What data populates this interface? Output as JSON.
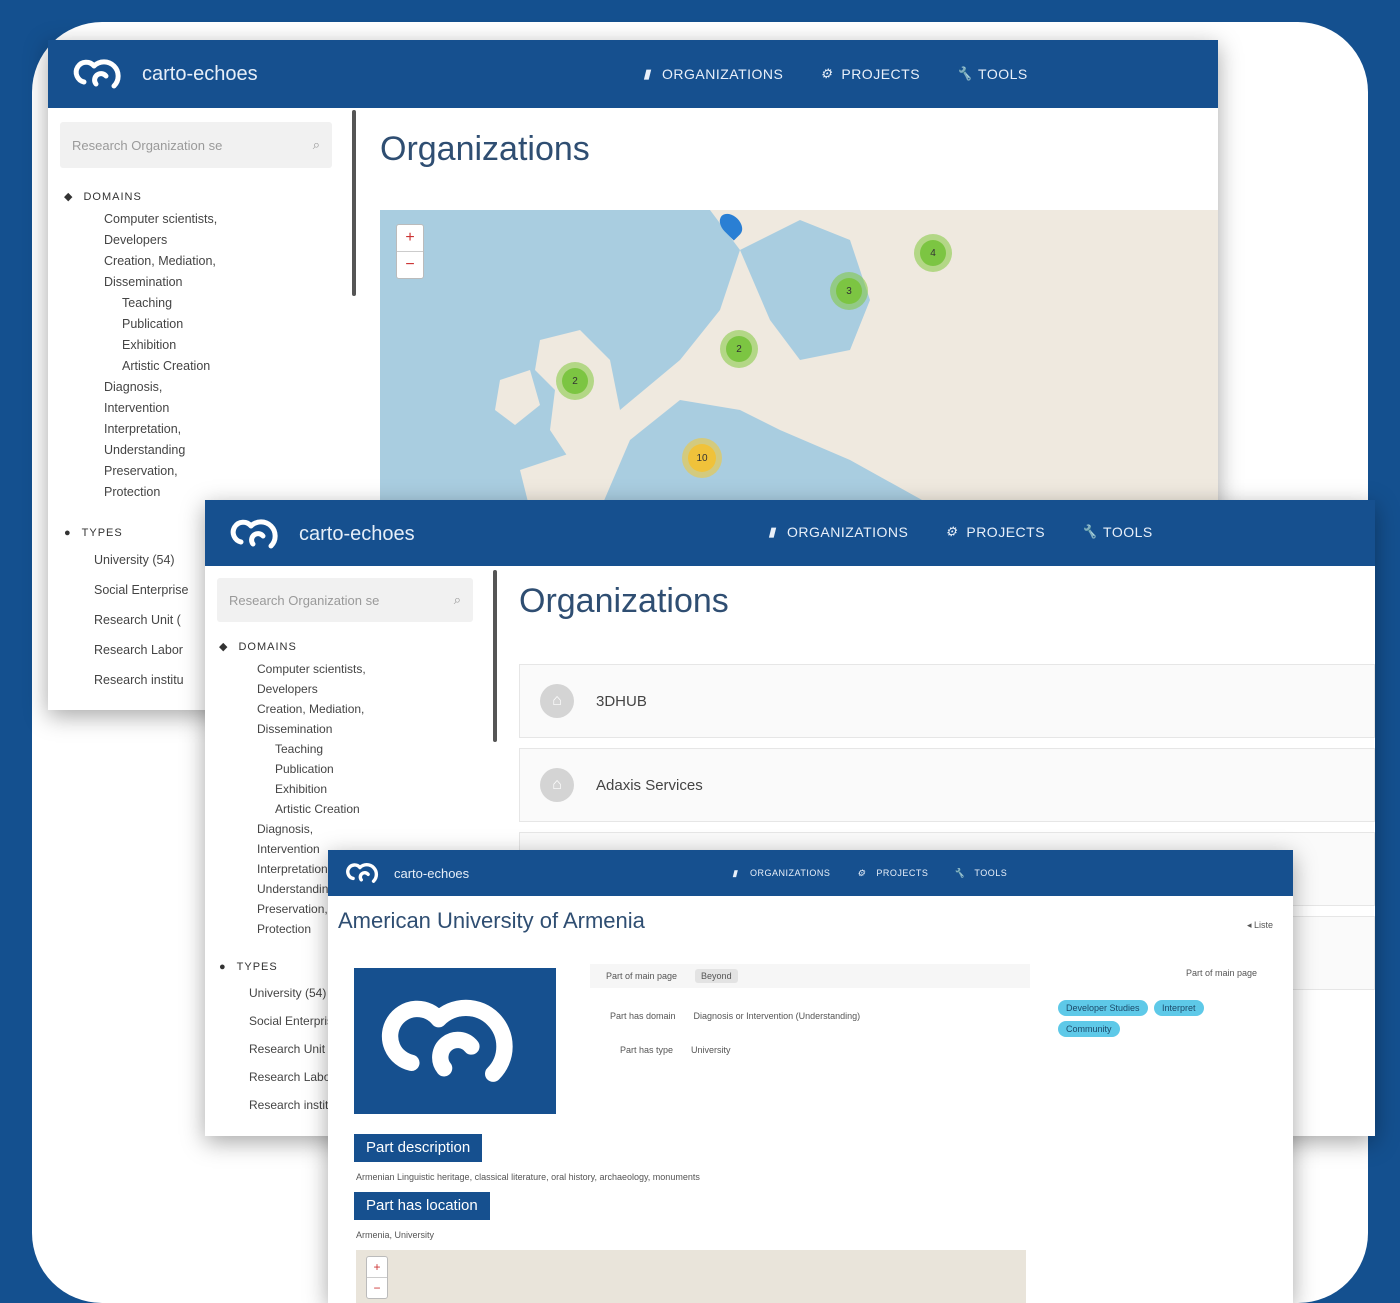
{
  "brand": {
    "name": "carto-echoes"
  },
  "nav": {
    "organizations": "ORGANIZATIONS",
    "projects": "PROJECTS",
    "tools": "TOOLS"
  },
  "search": {
    "placeholder": "Research Organization se"
  },
  "sidebar": {
    "domains_title": "DOMAINS",
    "domains": [
      "Computer scientists,",
      "Developers",
      "Creation, Mediation,",
      "Dissemination",
      "Teaching",
      "Publication",
      "Exhibition",
      "Artistic Creation",
      "Diagnosis,",
      "Intervention",
      "Interpretation,",
      "Understanding",
      "Preservation,",
      "Protection"
    ],
    "types_title": "TYPES",
    "types": [
      "University (54)",
      "Social Enterprise",
      "Research Unit (",
      "Research Labor",
      "Research institu"
    ]
  },
  "window1": {
    "page_title": "Organizations",
    "map": {
      "zoom_in": "+",
      "zoom_out": "−",
      "clusters": [
        {
          "label": "4",
          "color": "green"
        },
        {
          "label": "3",
          "color": "green"
        },
        {
          "label": "2",
          "color": "green"
        },
        {
          "label": "2",
          "color": "green"
        },
        {
          "label": "10",
          "color": "yellow"
        }
      ]
    }
  },
  "window2": {
    "page_title": "Organizations",
    "orgs": [
      "3DHUB",
      "Adaxis Services"
    ]
  },
  "window3": {
    "title": "American University of Armenia",
    "back_link": "◂ Liste",
    "fields": [
      {
        "label": "Part of main page",
        "value": "Beyond"
      },
      {
        "label": "Part has domain",
        "value": "Diagnosis or Intervention (Understanding)"
      },
      {
        "label": "Part has type",
        "value": "University"
      }
    ],
    "right_note": "Part of main page",
    "tags": [
      "Developer Studies",
      "Interpret",
      "Community"
    ],
    "description_label": "Part description",
    "description_text": "Armenian Linguistic heritage, classical literature, oral history, archaeology, monuments",
    "location_label": "Part has location",
    "location_text": "Armenia, University",
    "zoom_in": "+",
    "zoom_out": "−"
  },
  "colors": {
    "navy": "#16508f",
    "frame": "#14508f",
    "tag": "#5ec9e8",
    "cluster_green": "#7cc542",
    "cluster_yellow": "#f0c23a"
  }
}
